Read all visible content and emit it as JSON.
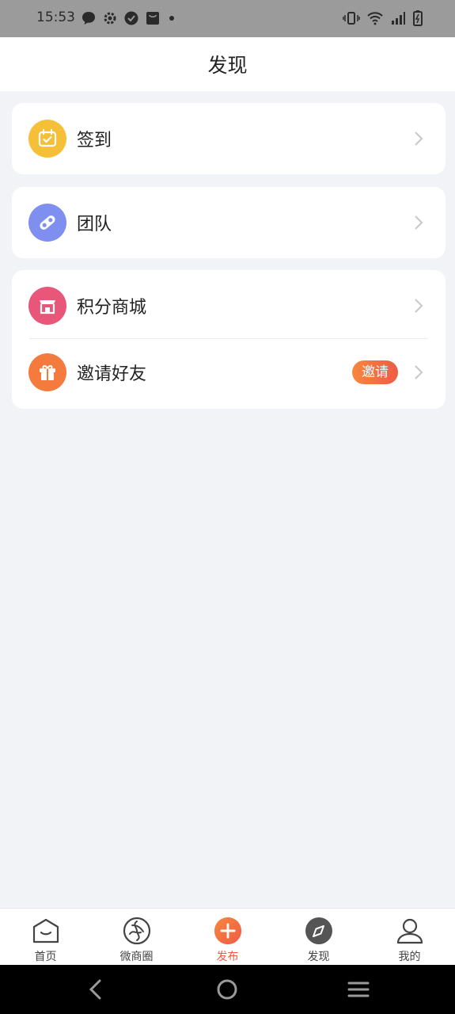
{
  "status": {
    "time": "15:53",
    "left_icons": [
      "message-icon",
      "settings-icon",
      "check-circle-icon",
      "bag-icon",
      "dot-icon"
    ],
    "right_icons": [
      "vibrate-icon",
      "wifi-icon",
      "signal-icon",
      "battery-icon"
    ]
  },
  "header": {
    "title": "发现"
  },
  "cards": [
    {
      "items": [
        {
          "label": "签到",
          "icon": "calendar-check-icon"
        }
      ]
    },
    {
      "items": [
        {
          "label": "团队",
          "icon": "team-icon"
        }
      ]
    },
    {
      "items": [
        {
          "label": "积分商城",
          "icon": "store-icon"
        },
        {
          "label": "邀请好友",
          "icon": "gift-icon",
          "badge": "邀请"
        }
      ]
    }
  ],
  "tabbar": {
    "items": [
      {
        "label": "首页",
        "icon": "home-icon"
      },
      {
        "label": "微商圈",
        "icon": "circle-swirl-icon"
      },
      {
        "label": "发布",
        "icon": "plus-icon",
        "active": true
      },
      {
        "label": "发现",
        "icon": "compass-icon"
      },
      {
        "label": "我的",
        "icon": "user-icon"
      }
    ]
  },
  "colors": {
    "accent": "#ef5b46",
    "signin_icon_bg": "#f6bf38",
    "team_icon_bg": "#7e8ff0",
    "store_icon_bg": "#e8567a",
    "gift_icon_bg": "#f47a3d"
  },
  "navbar": {
    "buttons": [
      "back-icon",
      "home-circle-icon",
      "menu-icon"
    ]
  }
}
